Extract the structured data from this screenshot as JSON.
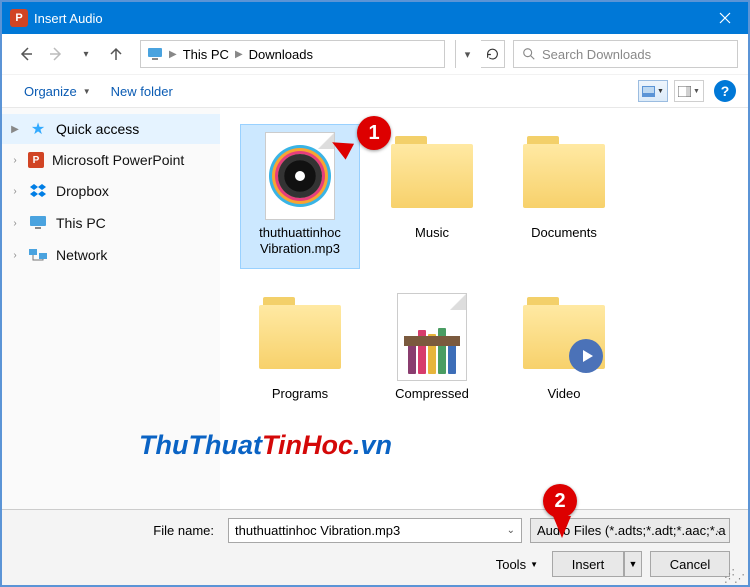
{
  "titlebar": {
    "title": "Insert Audio",
    "appletter": "P"
  },
  "nav": {
    "path": [
      "This PC",
      "Downloads"
    ],
    "search_placeholder": "Search Downloads"
  },
  "commands": {
    "organize": "Organize",
    "newfolder": "New folder",
    "help": "?"
  },
  "sidebar": {
    "items": [
      {
        "label": "Quick access",
        "icon": "star",
        "active": true,
        "expandable": true
      },
      {
        "label": "Microsoft PowerPoint",
        "icon": "pp",
        "expandable": true
      },
      {
        "label": "Dropbox",
        "icon": "db",
        "expandable": true
      },
      {
        "label": "This PC",
        "icon": "pc",
        "expandable": true
      },
      {
        "label": "Network",
        "icon": "net",
        "expandable": true
      }
    ]
  },
  "files": [
    {
      "name": "thuthuattinhoc Vibration.mp3",
      "type": "audio",
      "selected": true
    },
    {
      "name": "Music",
      "type": "folder"
    },
    {
      "name": "Documents",
      "type": "folder"
    },
    {
      "name": "Programs",
      "type": "folder"
    },
    {
      "name": "Compressed",
      "type": "rar"
    },
    {
      "name": "Video",
      "type": "folder-video"
    }
  ],
  "bottom": {
    "filename_label": "File name:",
    "filename_value": "thuthuattinhoc Vibration.mp3",
    "filetype_value": "Audio Files (*.adts;*.adt;*.aac;*.a",
    "tools": "Tools",
    "insert": "Insert",
    "cancel": "Cancel"
  },
  "annotations": {
    "one": "1",
    "two": "2"
  },
  "watermark": {
    "part1": "ThuThuat",
    "part2": "TinHoc",
    "part3": ".vn"
  }
}
